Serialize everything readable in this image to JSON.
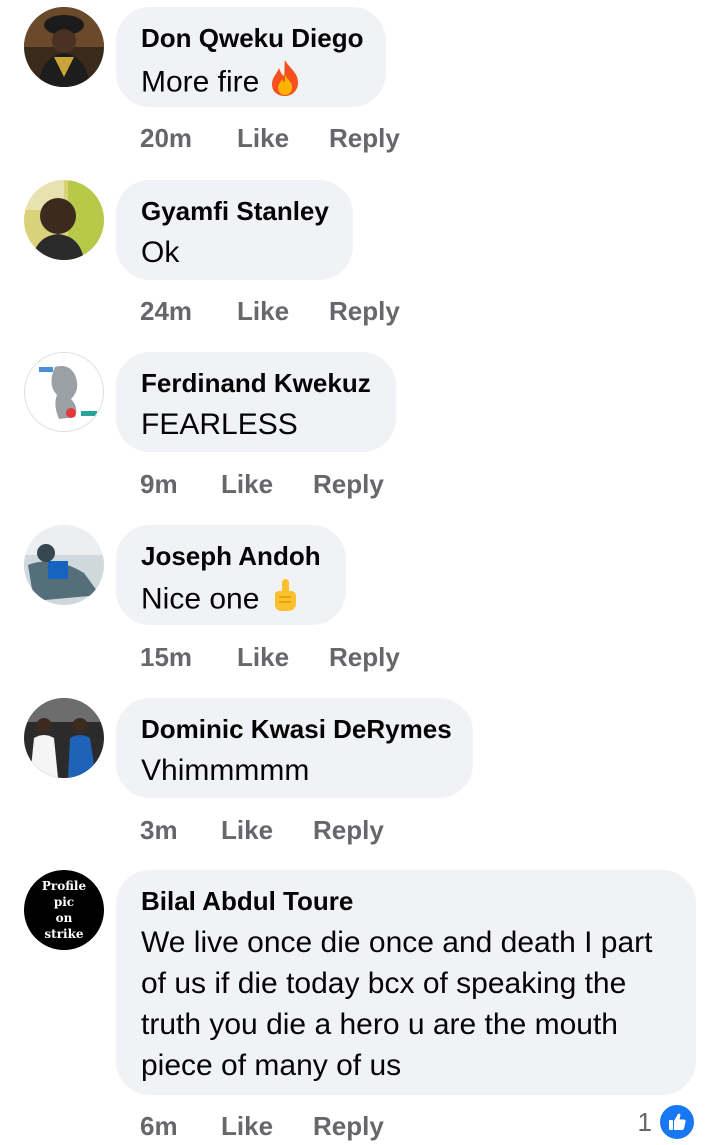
{
  "comments": [
    {
      "author": "Don Qweku Diego",
      "text": "More fire",
      "emoji": "fire-emoji",
      "time": "20m",
      "like_label": "Like",
      "reply_label": "Reply"
    },
    {
      "author": "Gyamfi Stanley",
      "text": "Ok",
      "time": "24m",
      "like_label": "Like",
      "reply_label": "Reply"
    },
    {
      "author": "Ferdinand Kwekuz",
      "text": "FEARLESS",
      "time": "9m",
      "like_label": "Like",
      "reply_label": "Reply"
    },
    {
      "author": "Joseph Andoh",
      "text": "Nice one",
      "emoji": "index-pointing-up-emoji",
      "time": "15m",
      "like_label": "Like",
      "reply_label": "Reply"
    },
    {
      "author": "Dominic Kwasi DeRymes",
      "text": "Vhimmmmm",
      "time": "3m",
      "like_label": "Like",
      "reply_label": "Reply"
    },
    {
      "author": "Bilal Abdul Toure",
      "text": "We live once die once and death I part of us if die today bcx of speaking the truth you die a hero u are the mouth piece of many of us",
      "time": "6m",
      "like_label": "Like",
      "reply_label": "Reply",
      "reaction_count": "1",
      "reaction_icon": "thumbs-up-icon",
      "avatar_text": [
        "Profile",
        "pic",
        "on",
        "strike"
      ]
    }
  ],
  "colors": {
    "bubble": "#f0f2f5",
    "meta": "#65676b",
    "like_blue": "#1877f2"
  }
}
